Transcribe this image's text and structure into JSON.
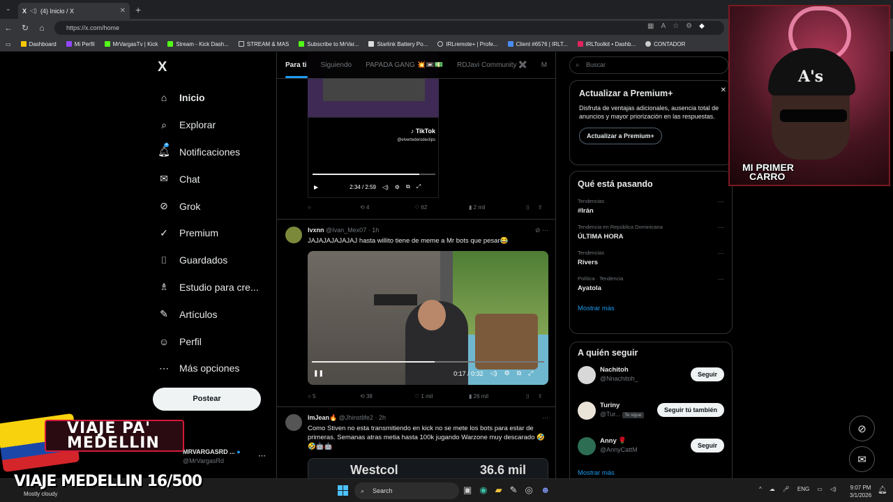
{
  "browser": {
    "tab_title": "(4) Inicio / X",
    "url": "https://x.com/home",
    "bookmarks": [
      "Dashboard",
      "Mi Perfil",
      "MrVargasTv | Kick",
      "Stream - Kick Dash...",
      "STREAM & MAS",
      "Subscribe to MrVar...",
      "Starlink Battery Po...",
      "IRLremote+ | Profe...",
      "Client #6576 | IRLT...",
      "IRLToolkit • Dashb...",
      "CONTADOR"
    ]
  },
  "sidebar": {
    "logo": "X",
    "items": [
      {
        "label": "Inicio",
        "icon": "home-icon",
        "glyph": "⌂"
      },
      {
        "label": "Explorar",
        "icon": "search-icon",
        "glyph": "⌕"
      },
      {
        "label": "Notificaciones",
        "icon": "bell-icon",
        "glyph": "🔔︎"
      },
      {
        "label": "Chat",
        "icon": "mail-icon",
        "glyph": "✉"
      },
      {
        "label": "Grok",
        "icon": "grok-icon",
        "glyph": "⊘"
      },
      {
        "label": "Premium",
        "icon": "verified-icon",
        "glyph": "✓"
      },
      {
        "label": "Guardados",
        "icon": "bookmark-icon",
        "glyph": "⌷"
      },
      {
        "label": "Estudio para cre...",
        "icon": "studio-icon",
        "glyph": "♗"
      },
      {
        "label": "Artículos",
        "icon": "articles-icon",
        "glyph": "✎"
      },
      {
        "label": "Perfil",
        "icon": "person-icon",
        "glyph": "☺"
      },
      {
        "label": "Más opciones",
        "icon": "more-icon",
        "glyph": "⋯"
      }
    ],
    "notification_count": "4",
    "post_button": "Postear",
    "profile": {
      "name": "MRVARGASRD ...",
      "handle": "@MrVargasRd"
    }
  },
  "feed": {
    "tabs": [
      "Para ti",
      "Siguiendo",
      "PAPADA GANG 💥📼💵",
      "RDJavi Community ✖️",
      "M"
    ],
    "video1": {
      "brand": "TikTok",
      "user": "@elvertederodeclips",
      "time": "2:34 / 2:59",
      "progress": 0.87
    },
    "actions1": {
      "replies": "",
      "reposts": "4",
      "likes": "62",
      "views": "2 mil"
    },
    "tweet2": {
      "name": "lvxnn",
      "handle": "@Ivan_Mex07",
      "time": "· 1h",
      "text": "JAJAJAJAJAJAJ hasta willito tiene de meme a Mr bots que pesar😂",
      "video_time": "0:17 / 0:32",
      "progress": 0.53,
      "replies": "5",
      "reposts": "38",
      "likes": "1 mil",
      "views": "26 mil"
    },
    "tweet3": {
      "name": "ImJean🔥",
      "handle": "@Jhinstlife2",
      "time": "· 2h",
      "text": "Como Stiven no esta transmitiendo en kick no se mete los bots para estar de primeras. Semanas atras metia hasta 100k jugando Warzone  muy descarado 🤣🤣🤖🤖",
      "preview_left": "Westcol",
      "preview_right": "36.6 mil"
    }
  },
  "right": {
    "search_placeholder": "Buscar",
    "premium": {
      "title": "Actualizar a Premium+",
      "body": "Disfruta de ventajas adicionales, ausencia total de anuncios y mayor priorización en las respuestas.",
      "button": "Actualizar a Premium+"
    },
    "trends_title": "Qué está pasando",
    "trends": [
      {
        "meta": "Tendencias",
        "name": "#Irán"
      },
      {
        "meta": "Tendencia en República Dominicana",
        "name": "ÚLTIMA HORA"
      },
      {
        "meta": "Tendencias",
        "name": "Rivers"
      },
      {
        "meta": "Política · Tendencia",
        "name": "Ayatola"
      }
    ],
    "show_more": "Mostrar más",
    "follow_title": "A quién seguir",
    "follow": [
      {
        "name": "Nachitoh",
        "handle": "@Nnachitoh_",
        "badge": "",
        "button": "Seguir",
        "color": "#d8d8d8"
      },
      {
        "name": "Turiny",
        "handle": "@Tur...",
        "badge": "Te sigue",
        "button": "Seguir tú también",
        "color": "#e9e3d8"
      },
      {
        "name": "Anny 🌹",
        "handle": "@AnnyCattM",
        "badge": "",
        "button": "Seguir",
        "color": "#2c6d54"
      }
    ],
    "follow_more": "Mostrar más"
  },
  "overlay": {
    "cam_label_1": "MI PRIMER",
    "cam_label_2": "CARRO",
    "hat_text": "A's",
    "banner_1": "VIAJE PA'",
    "banner_2": "MEDELLIN",
    "counter": "VIAJE MEDELLIN 16/500",
    "weather": "Mostly cloudy"
  },
  "taskbar": {
    "search": "Search",
    "lang": "ENG",
    "time": "9:07 PM",
    "date": "3/1/2026"
  }
}
